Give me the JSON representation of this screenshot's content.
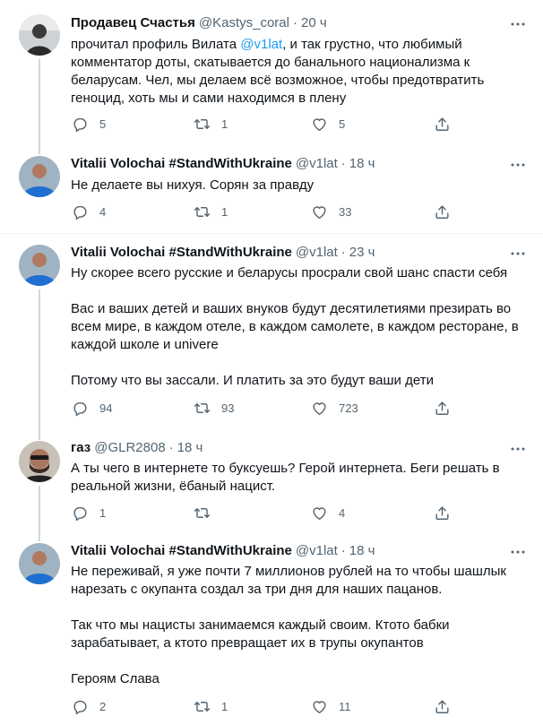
{
  "tweets": [
    {
      "name": "Продавец Счастья",
      "handle": "@Kastys_coral",
      "time": "20 ч",
      "paragraphs": [
        [
          "прочитал профиль Вилата ",
          "@v1lat",
          ", и так грустно, что любимый"
        ],
        [
          "комментатор доты, скатывается до банального национализма к"
        ],
        [
          "беларусам. Чел, мы делаем всё возможное, чтобы предотвратить"
        ],
        [
          "геноцид, хоть мы и сами находимся в плену"
        ]
      ],
      "replies": "5",
      "retweets": "1",
      "likes": "5"
    },
    {
      "name": "Vitalii Volochai #StandWithUkraine",
      "handle": "@v1lat",
      "time": "18 ч",
      "text": "Не делаете вы нихуя. Сорян за правду",
      "replies": "4",
      "retweets": "1",
      "likes": "33"
    },
    {
      "name": "Vitalii Volochai #StandWithUkraine",
      "handle": "@v1lat",
      "time": "23 ч",
      "lines": [
        "Ну скорее всего русские и беларусы просрали свой шанс спасти себя",
        "",
        "Вас и ваших детей и ваших внуков будут десятилетиями презирать во",
        "всем мире, в каждом отеле, в каждом самолете, в каждом ресторане, в",
        "каждой школе и univere",
        "",
        "Потому что вы зассали. И платить за это будут ваши дети"
      ],
      "replies": "94",
      "retweets": "93",
      "likes": "723"
    },
    {
      "name": "газ",
      "handle": "@GLR2808",
      "time": "18 ч",
      "lines": [
        "А ты чего в интернете то буксуешь? Герой интернета. Беги решать в",
        "реальной жизни, ёбаный нацист."
      ],
      "replies": "1",
      "retweets": "",
      "likes": "4"
    },
    {
      "name": "Vitalii Volochai #StandWithUkraine",
      "handle": "@v1lat",
      "time": "18 ч",
      "lines": [
        "Не переживай, я уже почти 7 миллионов рублей на то чтобы шашлык",
        "нарезать с окупанта создал за три дня для наших пацанов.",
        "",
        "Так что мы нацисты занимаемся каждый своим. Ктото бабки",
        "зарабатывает, а ктото превращает их в трупы окупантов",
        "",
        "Героям Слава"
      ],
      "replies": "2",
      "retweets": "1",
      "likes": "11"
    }
  ],
  "icons": {
    "more": "more-icon",
    "reply": "reply-icon",
    "retweet": "retweet-icon",
    "like": "like-icon",
    "share": "share-icon"
  },
  "colors": {
    "mention": "#1d9bf0",
    "secondary_text": "#536471",
    "thread_line": "#cfd9de"
  }
}
